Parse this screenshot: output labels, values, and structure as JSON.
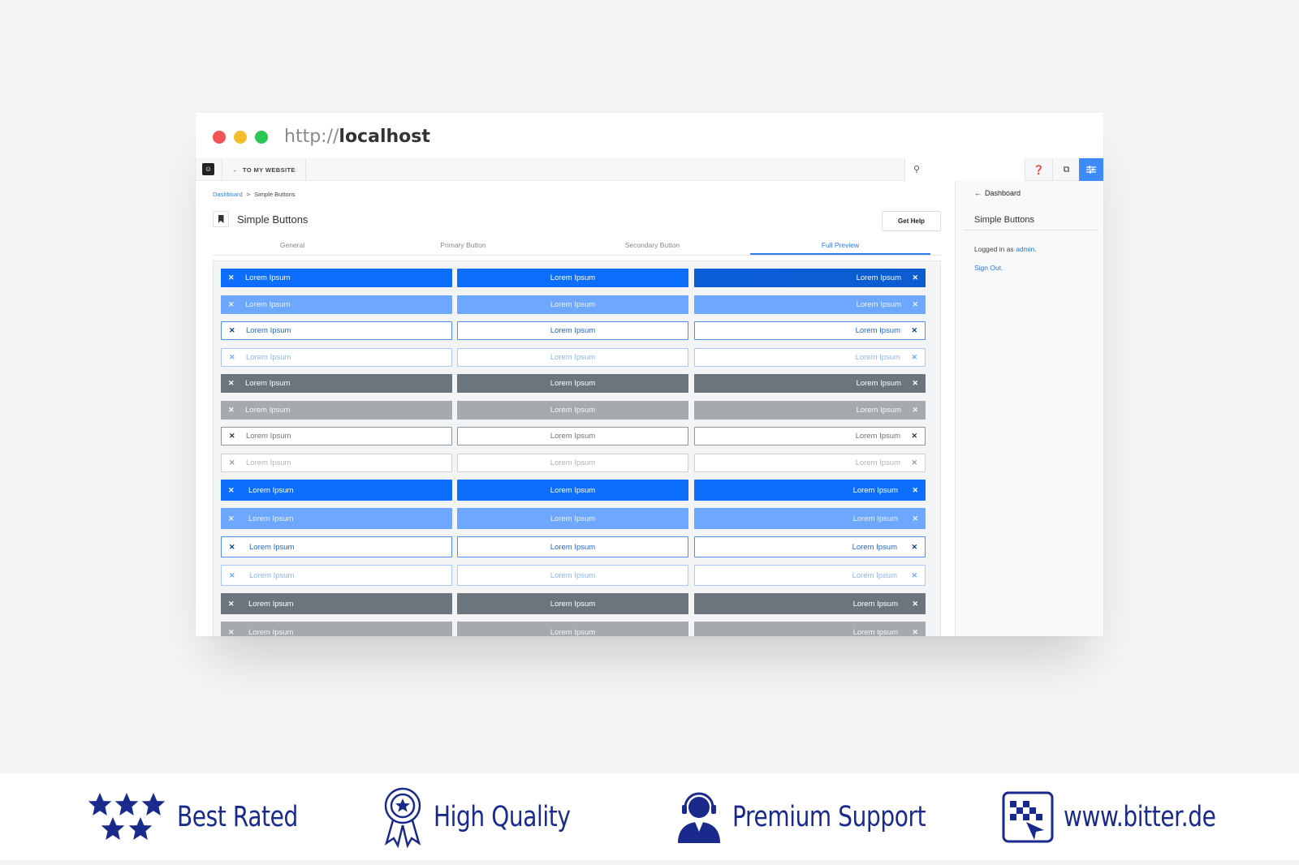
{
  "browser": {
    "url_scheme": "http://",
    "url_host": "localhost"
  },
  "topbar": {
    "logo_icon": "concrete-logo-icon",
    "back_label": "TO MY WEBSITE",
    "search_placeholder": "",
    "icons": [
      "help-icon",
      "copy-icon",
      "settings-sliders-icon"
    ],
    "accent": "#3d8bf8"
  },
  "breadcrumb": {
    "parent": "Dashboard",
    "separator": ">",
    "current": "Simple Buttons"
  },
  "page": {
    "title": "Simple Buttons",
    "help_button": "Get Help"
  },
  "tabs": [
    {
      "label": "General",
      "active": false
    },
    {
      "label": "Primary Button",
      "active": false
    },
    {
      "label": "Secondary Button",
      "active": false
    },
    {
      "label": "Full Preview",
      "active": true
    }
  ],
  "preview": {
    "button_label": "Lorem Ipsum",
    "close_glyph": "✕",
    "rows": [
      {
        "style": "s-blue",
        "col2_style": "s-blue-dark",
        "size": "small"
      },
      {
        "style": "s-blue-light",
        "size": "small"
      },
      {
        "style": "s-blue-out",
        "size": "small"
      },
      {
        "style": "s-blue-out-light",
        "size": "small"
      },
      {
        "style": "s-gray",
        "size": "small"
      },
      {
        "style": "s-gray-light",
        "size": "small"
      },
      {
        "style": "s-gray-out",
        "size": "small"
      },
      {
        "style": "s-gray-out-light",
        "size": "small"
      },
      {
        "style": "s-blue",
        "size": "big"
      },
      {
        "style": "s-blue-light",
        "size": "big"
      },
      {
        "style": "s-blue-out",
        "size": "big"
      },
      {
        "style": "s-blue-out-light",
        "size": "big"
      },
      {
        "style": "s-gray",
        "size": "big"
      },
      {
        "style": "s-gray-light",
        "size": "big"
      }
    ]
  },
  "sidebar": {
    "back_label": "Dashboard",
    "title": "Simple Buttons",
    "logged_in_prefix": "Logged in as",
    "user": "admin",
    "logged_in_suffix": ".",
    "sign_out": "Sign Out."
  },
  "footer": {
    "color": "#1a2a8c",
    "features": [
      {
        "icon": "stars-icon",
        "label": "Best Rated"
      },
      {
        "icon": "award-ribbon-icon",
        "label": "High Quality"
      },
      {
        "icon": "support-agent-icon",
        "label": "Premium Support"
      },
      {
        "icon": "bitter-logo-icon",
        "label": "www.bitter.de"
      }
    ]
  }
}
